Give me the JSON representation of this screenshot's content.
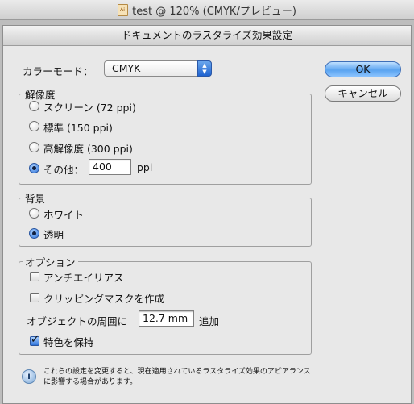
{
  "window": {
    "title": "test @ 120% (CMYK/プレビュー)"
  },
  "dialog": {
    "title": "ドキュメントのラスタライズ効果設定",
    "color_mode": {
      "label": "カラーモード：",
      "value": "CMYK"
    },
    "buttons": {
      "ok": "OK",
      "cancel": "キャンセル"
    },
    "resolution": {
      "legend": "解像度",
      "options": [
        {
          "label": "スクリーン (72 ppi)",
          "selected": false
        },
        {
          "label": "標準 (150 ppi)",
          "selected": false
        },
        {
          "label": "高解像度 (300 ppi)",
          "selected": false
        },
        {
          "label": "その他：",
          "selected": true
        }
      ],
      "other_value": "400",
      "unit": "ppi"
    },
    "background": {
      "legend": "背景",
      "options": [
        {
          "label": "ホワイト",
          "selected": false
        },
        {
          "label": "透明",
          "selected": true
        }
      ]
    },
    "options": {
      "legend": "オプション",
      "antialias": {
        "label": "アンチエイリアス",
        "checked": false
      },
      "clipping_mask": {
        "label": "クリッピングマスクを作成",
        "checked": false
      },
      "add_around": {
        "label": "オブジェクトの周囲に",
        "value": "12.7 mm",
        "suffix": "追加"
      },
      "preserve_spot": {
        "label": "特色を保持",
        "checked": true
      }
    },
    "note": {
      "icon": "info-icon",
      "lines": [
        "これらの設定を変更すると、現在適用されているラスタライズ効果のアピアランス",
        "に影響する場合があります。"
      ]
    }
  }
}
